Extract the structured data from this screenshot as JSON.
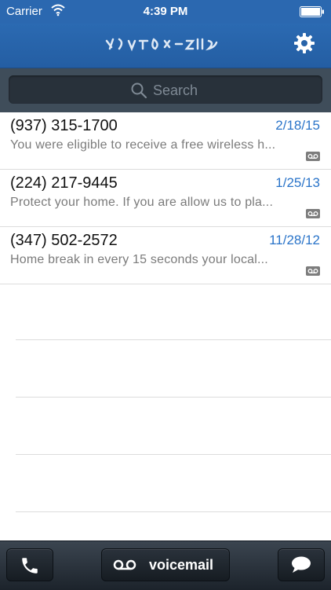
{
  "status_bar": {
    "carrier": "Carrier",
    "time": "4:39 PM"
  },
  "nav": {
    "title_scribble": "redacted-number",
    "settings_icon": "gear-icon"
  },
  "search": {
    "placeholder": "Search",
    "value": ""
  },
  "voicemails": [
    {
      "phone": "(937) 315-1700",
      "date": "2/18/15",
      "preview": "You were eligible to receive a free wireless h..."
    },
    {
      "phone": "(224) 217-9445",
      "date": "1/25/13",
      "preview": "Protect your home. If you are allow us to pla..."
    },
    {
      "phone": "(347) 502-2572",
      "date": "11/28/12",
      "preview": "Home break in every 15 seconds your local..."
    }
  ],
  "tabbar": {
    "voicemail_label": "voicemail"
  },
  "colors": {
    "header_blue": "#2b68b0",
    "search_bg": "#3f4d5a",
    "date_blue": "#2a74c9"
  }
}
